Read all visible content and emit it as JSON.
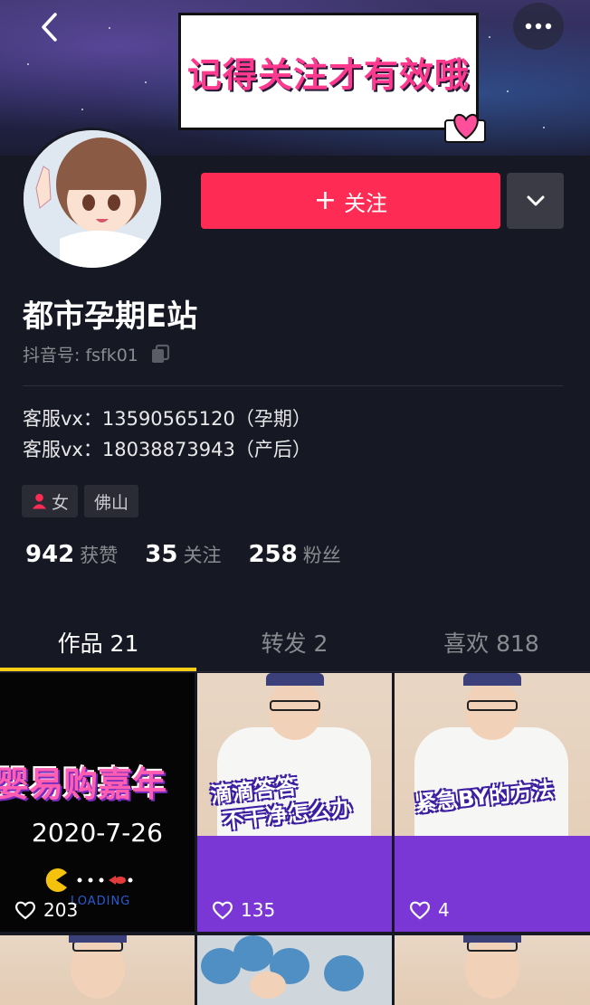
{
  "header": {
    "notice_text": "记得关注才有效哦"
  },
  "profile": {
    "nickname": "都市孕期E站",
    "douyin_id": "抖音号: fsfk01",
    "follow_label": "关注",
    "bio_lines": [
      "客服vx：13590565120（孕期）",
      "客服vx：18038873943（产后）"
    ],
    "tags": [
      {
        "label": "女",
        "icon": "female-icon"
      },
      {
        "label": "佛山"
      }
    ],
    "stats": [
      {
        "value": "942",
        "label": "获赞"
      },
      {
        "value": "35",
        "label": "关注"
      },
      {
        "value": "258",
        "label": "粉丝"
      }
    ]
  },
  "tabs": [
    {
      "label": "作品 21",
      "active": true
    },
    {
      "label": "转发 2",
      "active": false
    },
    {
      "label": "喜欢 818",
      "active": false
    }
  ],
  "videos": [
    {
      "title": "婴易购嘉年",
      "date": "2020-7-26",
      "loading": "LOADING",
      "likes": "203"
    },
    {
      "caption_line1": "滴滴答答",
      "caption_line2": "不干净怎么办",
      "likes": "135"
    },
    {
      "caption_line1": "紧急BY的方法",
      "likes": "4"
    }
  ],
  "colors": {
    "accent": "#fe2c55",
    "tab_indicator": "#face15",
    "background": "#161823"
  }
}
